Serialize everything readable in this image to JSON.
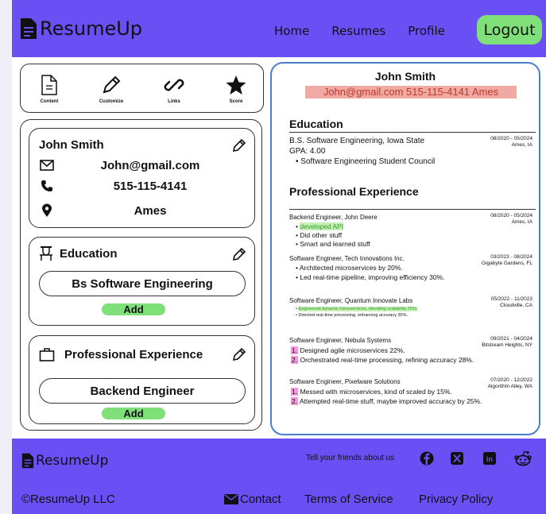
{
  "header": {
    "brand": "ResumeUp",
    "nav": [
      "Home",
      "Resumes",
      "Profile"
    ],
    "logout": "Logout"
  },
  "toolbar": {
    "items": [
      {
        "label": "Content",
        "icon": "document-icon"
      },
      {
        "label": "Customize",
        "icon": "pencil-icon"
      },
      {
        "label": "Links",
        "icon": "link-icon"
      },
      {
        "label": "Score",
        "icon": "star-icon"
      }
    ]
  },
  "contact_card": {
    "name": "John Smith",
    "email": "John@gmail.com",
    "phone": "515-115-4141",
    "location": "Ames"
  },
  "education_card": {
    "title": "Education",
    "entry": "Bs Software Engineering",
    "add": "Add"
  },
  "experience_card": {
    "title": "Professional Experience",
    "entry": "Backend Engineer",
    "add": "Add"
  },
  "preview": {
    "name": "John Smith",
    "contact": "John@gmail.com 515-115-4141 Ames",
    "education_heading": "Education",
    "edu": {
      "title": "B.S. Software Engineering, Iowa State",
      "gpa": "GPA: 4.00",
      "bullet": "Software Engineering Student Council",
      "dates": "08/2020 - 05/2024",
      "place": "Ames, IA"
    },
    "experience_heading": "Professional Experience",
    "jobs": [
      {
        "title": "Backend Engineer, John Deere",
        "dates": "08/2020 - 05/2024",
        "place": "Ames, IA",
        "bullets": [
          "developed API",
          "Did other stuff",
          "Smart and learned stuff"
        ]
      },
      {
        "title": "Software Engineer, Tech Innovations Inc.",
        "dates": "03/2023 - 08/2024",
        "place": "Gigabyte Gardens, FL",
        "bullets": [
          "Architected microservices by 20%.",
          "Led real-time pipeline, improving efficiency 30%."
        ]
      },
      {
        "title": "Software Engineer, Quantum Innovate Labs",
        "dates": "05/2022 - 11/2023",
        "place": "Cloudville, CA",
        "bullets": [
          "Engineered dynamic microservices, elevating scalability 25%.",
          "Directed real-time processing, enhancing accuracy 35%."
        ]
      },
      {
        "title": "Software Engineer, Nebula Systems",
        "dates": "09/2021 - 04/2024",
        "place": "Bitstream Heights, NY",
        "bullets": [
          "Designed agile microservices 22%.",
          "Orchestrated real-time processing, refining accuracy 28%."
        ]
      },
      {
        "title": "Software Engineer, Pixelware Solutions",
        "dates": "07/2020 - 12/2022",
        "place": "Algorithm Alley, WA",
        "bullets": [
          "Messed with microservices, kind of scaled by 15%.",
          "Attempted real-time stuff, maybe improved accuracy by 25%."
        ]
      }
    ]
  },
  "footer": {
    "brand": "ResumeUp",
    "tell": "Tell your friends about us",
    "copyright": "©ResumeUp LLC",
    "contact": "Contact",
    "terms": "Terms of Service",
    "privacy": "Privacy Policy"
  },
  "colors": {
    "brand": "#6a4ff5",
    "accent_green": "#7fe07a",
    "preview_border": "#4a7fd0",
    "contact_highlight": "#f1a9a3"
  }
}
